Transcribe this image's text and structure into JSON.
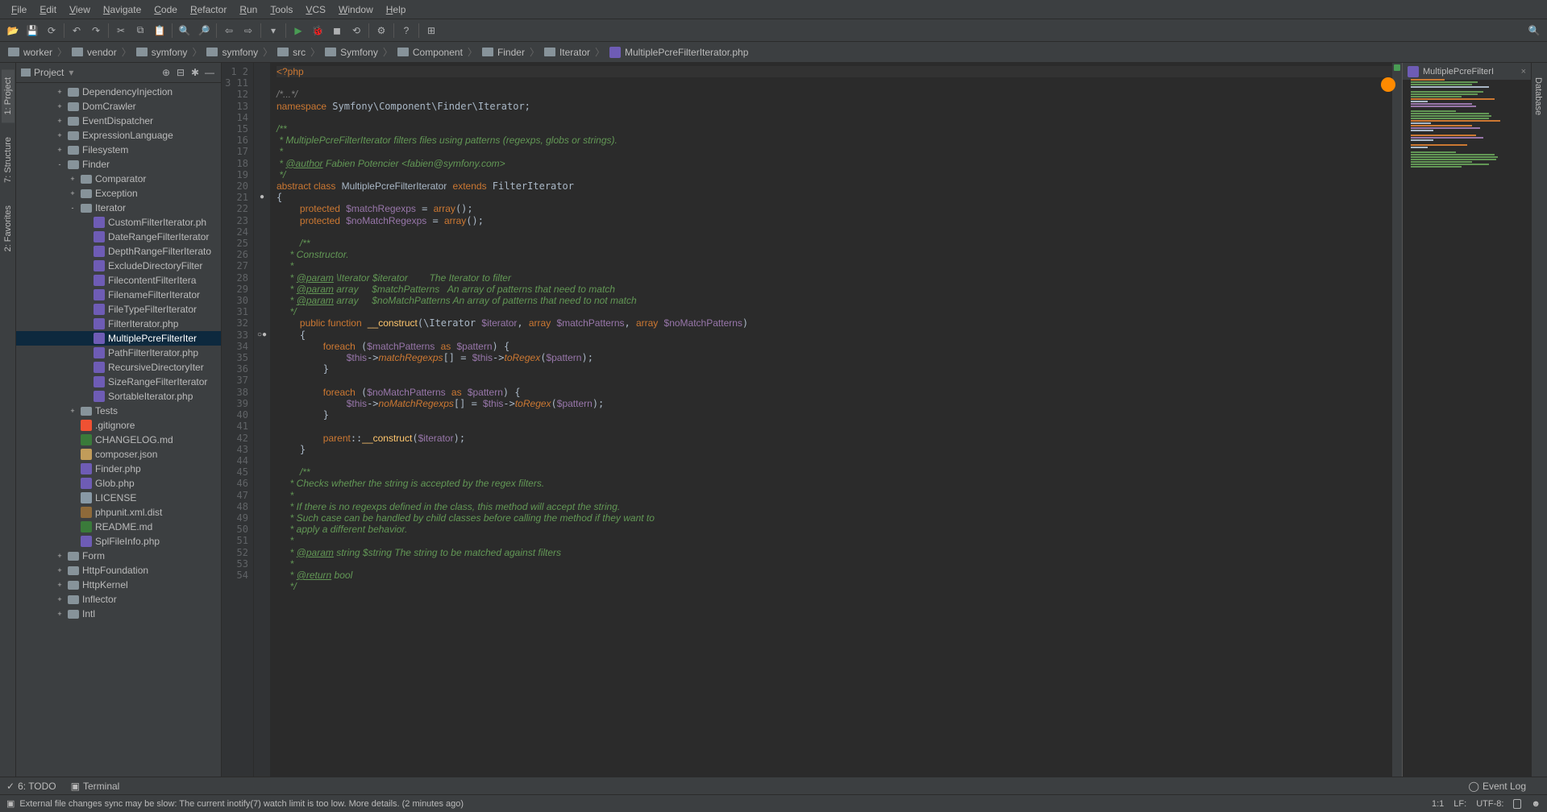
{
  "menu": [
    "File",
    "Edit",
    "View",
    "Navigate",
    "Code",
    "Refactor",
    "Run",
    "Tools",
    "VCS",
    "Window",
    "Help"
  ],
  "breadcrumbs": [
    "worker",
    "vendor",
    "symfony",
    "symfony",
    "src",
    "Symfony",
    "Component",
    "Finder",
    "Iterator",
    "MultiplePcreFilterIterator.php"
  ],
  "sidebar": {
    "title": "Project",
    "tree": [
      {
        "depth": 3,
        "arrow": "+",
        "icon": "folder",
        "label": "DependencyInjection"
      },
      {
        "depth": 3,
        "arrow": "+",
        "icon": "folder",
        "label": "DomCrawler"
      },
      {
        "depth": 3,
        "arrow": "+",
        "icon": "folder",
        "label": "EventDispatcher"
      },
      {
        "depth": 3,
        "arrow": "+",
        "icon": "folder",
        "label": "ExpressionLanguage"
      },
      {
        "depth": 3,
        "arrow": "+",
        "icon": "folder",
        "label": "Filesystem"
      },
      {
        "depth": 3,
        "arrow": "-",
        "icon": "folder",
        "label": "Finder"
      },
      {
        "depth": 4,
        "arrow": "+",
        "icon": "folder",
        "label": "Comparator"
      },
      {
        "depth": 4,
        "arrow": "+",
        "icon": "folder",
        "label": "Exception"
      },
      {
        "depth": 4,
        "arrow": "-",
        "icon": "folder",
        "label": "Iterator"
      },
      {
        "depth": 5,
        "arrow": "",
        "icon": "php",
        "label": "CustomFilterIterator.ph"
      },
      {
        "depth": 5,
        "arrow": "",
        "icon": "php",
        "label": "DateRangeFilterIterator"
      },
      {
        "depth": 5,
        "arrow": "",
        "icon": "php",
        "label": "DepthRangeFilterIterato"
      },
      {
        "depth": 5,
        "arrow": "",
        "icon": "php",
        "label": "ExcludeDirectoryFilter"
      },
      {
        "depth": 5,
        "arrow": "",
        "icon": "php",
        "label": "FilecontentFilterItera"
      },
      {
        "depth": 5,
        "arrow": "",
        "icon": "php",
        "label": "FilenameFilterIterator"
      },
      {
        "depth": 5,
        "arrow": "",
        "icon": "php",
        "label": "FileTypeFilterIterator"
      },
      {
        "depth": 5,
        "arrow": "",
        "icon": "php",
        "label": "FilterIterator.php"
      },
      {
        "depth": 5,
        "arrow": "",
        "icon": "php",
        "label": "MultiplePcreFilterIter",
        "sel": true
      },
      {
        "depth": 5,
        "arrow": "",
        "icon": "php",
        "label": "PathFilterIterator.php"
      },
      {
        "depth": 5,
        "arrow": "",
        "icon": "php",
        "label": "RecursiveDirectoryIter"
      },
      {
        "depth": 5,
        "arrow": "",
        "icon": "php",
        "label": "SizeRangeFilterIterator"
      },
      {
        "depth": 5,
        "arrow": "",
        "icon": "php",
        "label": "SortableIterator.php"
      },
      {
        "depth": 4,
        "arrow": "+",
        "icon": "folder",
        "label": "Tests"
      },
      {
        "depth": 4,
        "arrow": "",
        "icon": "git",
        "label": ".gitignore"
      },
      {
        "depth": 4,
        "arrow": "",
        "icon": "md",
        "label": "CHANGELOG.md"
      },
      {
        "depth": 4,
        "arrow": "",
        "icon": "json",
        "label": "composer.json"
      },
      {
        "depth": 4,
        "arrow": "",
        "icon": "php",
        "label": "Finder.php"
      },
      {
        "depth": 4,
        "arrow": "",
        "icon": "php",
        "label": "Glob.php"
      },
      {
        "depth": 4,
        "arrow": "",
        "icon": "txt",
        "label": "LICENSE"
      },
      {
        "depth": 4,
        "arrow": "",
        "icon": "xml",
        "label": "phpunit.xml.dist"
      },
      {
        "depth": 4,
        "arrow": "",
        "icon": "md",
        "label": "README.md"
      },
      {
        "depth": 4,
        "arrow": "",
        "icon": "php",
        "label": "SplFileInfo.php"
      },
      {
        "depth": 3,
        "arrow": "+",
        "icon": "folder",
        "label": "Form"
      },
      {
        "depth": 3,
        "arrow": "+",
        "icon": "folder",
        "label": "HttpFoundation"
      },
      {
        "depth": 3,
        "arrow": "+",
        "icon": "folder",
        "label": "HttpKernel"
      },
      {
        "depth": 3,
        "arrow": "+",
        "icon": "folder",
        "label": "Inflector"
      },
      {
        "depth": 3,
        "arrow": "+",
        "icon": "folder",
        "label": "Intl"
      }
    ]
  },
  "lefttabs": [
    {
      "label": "1: Project",
      "active": true
    },
    {
      "label": "7: Structure",
      "active": false
    },
    {
      "label": "2: Favorites",
      "active": false
    }
  ],
  "righttabs": [
    "Database"
  ],
  "gutter_lines": [
    "1",
    "2",
    "3",
    "11",
    "12",
    "13",
    "14",
    "15",
    "16",
    "17",
    "18",
    "19",
    "20",
    "21",
    "22",
    "23",
    "24",
    "25",
    "26",
    "27",
    "28",
    "29",
    "30",
    "31",
    "32",
    "33",
    "34",
    "35",
    "36",
    "37",
    "38",
    "39",
    "40",
    "41",
    "42",
    "43",
    "44",
    "45",
    "46",
    "47",
    "48",
    "49",
    "50",
    "51",
    "52",
    "53",
    "54"
  ],
  "editor_tab": "MultiplePcreFilterI",
  "bottombar": {
    "todo": "6: TODO",
    "terminal": "Terminal",
    "eventlog": "Event Log"
  },
  "status": {
    "msg": "External file changes sync may be slow: The current inotify(7) watch limit is too low. More details. (2 minutes ago)",
    "pos": "1:1",
    "eol": "LF:",
    "enc": "UTF-8:"
  }
}
